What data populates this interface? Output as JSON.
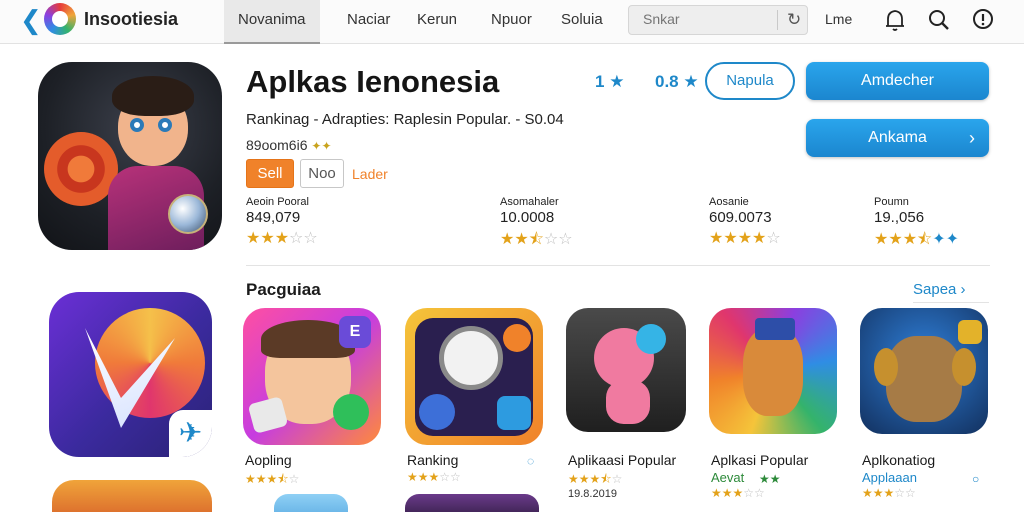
{
  "topbar": {
    "brand": "Insootiesia",
    "nav": [
      "Novanima",
      "Naciar",
      "Kerun",
      "Npuor",
      "Soluia"
    ],
    "search_placeholder": "Snkar",
    "right_text": "Lme"
  },
  "app": {
    "title": "Aplkas Ienonesia",
    "meta1": "1",
    "meta2": "0.8",
    "subtitle": "Rankinag - Adrapties: Raplesin Popular. - S0.04",
    "developer": "89oom6i6",
    "tag_sell": "Sell",
    "tag_neo": "Noo",
    "tag_link": "Lader",
    "btn_outline": "Napula",
    "btn_primary_1": "Amdecher",
    "btn_primary_2": "Ankama",
    "stats": [
      {
        "label": "Aeoin Pooral",
        "value": "849,079",
        "rating": 3
      },
      {
        "label": "Asomahaler",
        "value": "10.0008",
        "rating": 2.5
      },
      {
        "label": "Aosanie",
        "value": "609.0073",
        "rating": 4
      },
      {
        "label": "Poumn",
        "value": "19.,056",
        "rating": 3.5
      }
    ]
  },
  "section": {
    "title": "Pacguiaa",
    "see_all": "Sapea"
  },
  "tiles": [
    {
      "name": "Aopling",
      "rating": 3.5
    },
    {
      "name": "Ranking",
      "rating": 3
    },
    {
      "name": "Aplikaasi Popular",
      "rating": 3.5,
      "date": "19.8.2019"
    },
    {
      "name": "Aplkasi Popular",
      "sub": "Aevat",
      "rating": 3
    },
    {
      "name": "Aplkonatiog",
      "sub": "Applaaan",
      "rating": 3
    }
  ],
  "colors": {
    "accent": "#1e88c9",
    "orange": "#f0822a",
    "star": "#e3a21a"
  }
}
